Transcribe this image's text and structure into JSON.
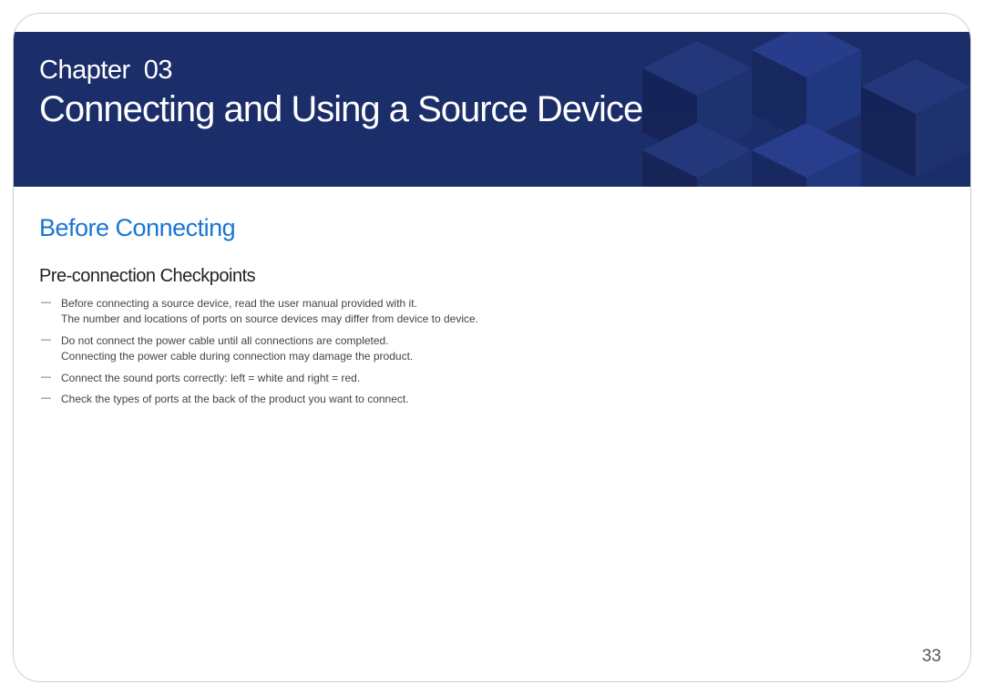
{
  "banner": {
    "chapter_label_prefix": "Chapter",
    "chapter_number": "03",
    "title": "Connecting and Using a Source Device"
  },
  "content": {
    "section_title": "Before Connecting",
    "subsection_title": "Pre-connection Checkpoints",
    "notes": [
      {
        "line1": "Before connecting a source device, read the user manual provided with it.",
        "line2": "The number and locations of ports on source devices may differ from device to device."
      },
      {
        "line1": "Do not connect the power cable until all connections are completed.",
        "line2": "Connecting the power cable during connection may damage the product."
      },
      {
        "line1": "Connect the sound ports correctly: left = white and right = red.",
        "line2": ""
      },
      {
        "line1": "Check the types of ports at the back of the product you want to connect.",
        "line2": ""
      }
    ]
  },
  "page_number": "33",
  "colors": {
    "banner_bg": "#1b2e6a",
    "accent_blue": "#1976d2"
  }
}
